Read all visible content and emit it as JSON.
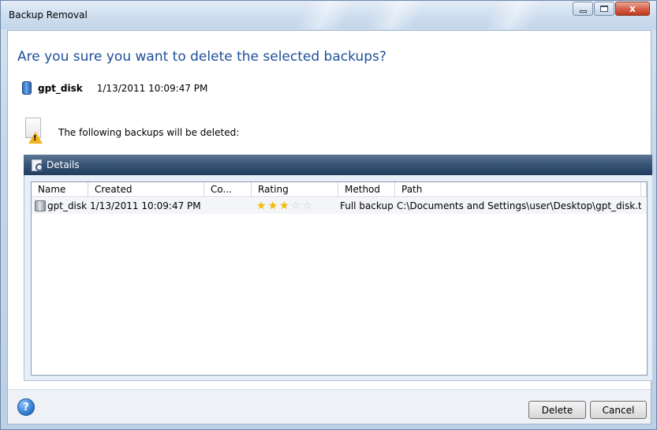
{
  "window": {
    "title": "Backup Removal",
    "close_glyph": "x"
  },
  "dialog": {
    "heading": "Are you sure you want to delete the selected backups?",
    "backup_name": "gpt_disk",
    "backup_date": "1/13/2011 10:09:47 PM",
    "warning_text": "The following backups will be deleted:"
  },
  "details": {
    "label": "Details",
    "columns": [
      "Name",
      "Created",
      "Co...",
      "Rating",
      "Method",
      "Path"
    ],
    "rows": [
      {
        "name": "gpt_disk",
        "created": "1/13/2011 10:09:47 PM",
        "comment": "",
        "rating": 3,
        "rating_max": 5,
        "method": "Full backup",
        "path": "C:\\Documents and Settings\\user\\Desktop\\gpt_disk.tib"
      }
    ]
  },
  "footer": {
    "help_glyph": "?",
    "delete_label": "Delete",
    "cancel_label": "Cancel"
  },
  "icons": {
    "title_min": "minimize-icon",
    "title_max": "maximize-icon",
    "title_close": "close-icon",
    "backup": "disk-icon",
    "warning": "warning-document-icon",
    "details": "details-icon",
    "help": "help-icon",
    "star": "star-icon"
  },
  "colors": {
    "heading": "#1e4e9a",
    "details_bar": "#3a5678",
    "star_on": "#f0b900",
    "star_off": "#c8ccd2"
  }
}
